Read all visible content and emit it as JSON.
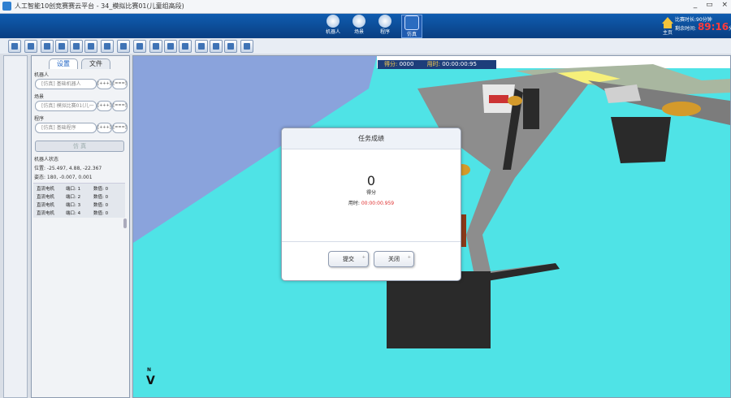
{
  "window": {
    "title": "人工智能10创竞赛赛云平台 - 34_模拟比赛01(儿童组高段)",
    "controls": [
      "_",
      "▭",
      "×"
    ]
  },
  "modes": [
    {
      "label": "机器人",
      "icon": "robot-icon",
      "active": false
    },
    {
      "label": "场景",
      "icon": "scene-icon",
      "active": false
    },
    {
      "label": "程序",
      "icon": "program-icon",
      "active": false
    },
    {
      "label": "仿真",
      "icon": "simulation-icon",
      "active": true
    }
  ],
  "header": {
    "home_label": "主页",
    "match_duration_label": "比赛时长:",
    "match_duration_value": "90分钟",
    "remaining_label": "剩余时间:",
    "remaining_value": "89:16",
    "remaining_unit": "分钟"
  },
  "toolbar_icons": [
    "new-icon",
    "save-icon",
    "print-icon",
    "play-icon",
    "binoculars-icon",
    "pen-icon",
    "object-icon",
    "image-icon",
    "calendar-icon",
    "leaf-icon",
    "person-icon",
    "panel-icon",
    "tool-icon",
    "rotate-icon",
    "eye-icon",
    "settings-icon"
  ],
  "panel": {
    "tabs": [
      {
        "label": "设置",
        "active": true
      },
      {
        "label": "文件",
        "active": false
      }
    ],
    "robot": {
      "label": "机器人",
      "value": "[仿真] 基础机器人",
      "btn1": "[+++]",
      "btn2": "[===]"
    },
    "scene": {
      "label": "场景",
      "value": "[仿真] 模拟比赛01(儿一",
      "btn1": "[+++]",
      "btn2": "[===]"
    },
    "program": {
      "label": "程序",
      "value": "[仿真] 基础程序",
      "btn1": "[+++]",
      "btn2": "[===]"
    },
    "sim_button": "仿 真",
    "status_title": "机器人状态",
    "position": "位置: -25.497, 4.88, -22.367",
    "attitude": "姿态: 180, -0.007, 0.001",
    "motors": [
      {
        "type": "直流电机",
        "port": "端口: 1",
        "value": "数值: 0"
      },
      {
        "type": "直流电机",
        "port": "端口: 2",
        "value": "数值: 0"
      },
      {
        "type": "直流电机",
        "port": "端口: 3",
        "value": "数值: 0"
      },
      {
        "type": "直流电机",
        "port": "端口: 4",
        "value": "数值: 0"
      }
    ]
  },
  "scorebar": {
    "score_label": "得分:",
    "score_value": "0000",
    "time_label": "用时:",
    "time_value": "00:00:00:95"
  },
  "dialog": {
    "title": "任务成绩",
    "score": "0",
    "score_label": "得分",
    "time_label": "用时:",
    "time_value": "00:00:00.959",
    "submit": "提交",
    "close": "关闭"
  },
  "compass": "N"
}
